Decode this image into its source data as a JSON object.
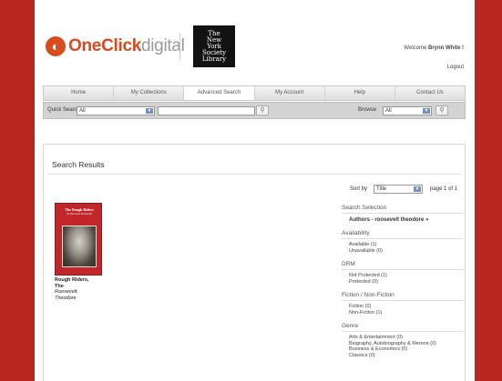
{
  "header": {
    "logo": {
      "one": "One",
      "click": "Click",
      "digital": "digital"
    },
    "library_logo_lines": [
      "The",
      "New",
      "York",
      "Society",
      "Library"
    ],
    "welcome_prefix": "Welcome ",
    "user_name": "Brynn White !",
    "logout": "Logout"
  },
  "nav": {
    "items": [
      "Home",
      "My Collections",
      "Advanced Search",
      "My Account",
      "Help",
      "Contact Us"
    ],
    "active_index": 2
  },
  "quickbar": {
    "quick_search_label": "Quick Search",
    "quick_search_select": "All",
    "quick_search_value": "",
    "browse_label": "Browse",
    "browse_select": "All",
    "search_icon": "magnifier-icon"
  },
  "results": {
    "title": "Search Results",
    "sort_label": "Sort by",
    "sort_value": "Title",
    "page_info": "page 1 of 1",
    "book": {
      "cover_title": "The Rough Riders",
      "cover_subtitle": "by Theodore Roosevelt",
      "title_line1": "Rough Riders,",
      "title_line2": "The",
      "author_line1": "Roosevelt,",
      "author_line2": "Theodore"
    }
  },
  "sidebar": {
    "selection_head": "Search Selection",
    "selection_value": "Authors - roosevelt theodore »",
    "sections": [
      {
        "head": "Availability",
        "items": [
          "Available (1)",
          "Unavailable (0)"
        ]
      },
      {
        "head": "DRM",
        "items": [
          "Not Protected (1)",
          "Protected (0)"
        ]
      },
      {
        "head": "Fiction / Non-Fiction",
        "items": [
          "Fiction (0)",
          "Non-Fiction (1)"
        ]
      },
      {
        "head": "Genre",
        "items": [
          "Arts & Entertainment (0)",
          "Biography, Autobiography & Memoir (0)",
          "Business & Economics (0)",
          "Classics (0)"
        ]
      }
    ]
  }
}
